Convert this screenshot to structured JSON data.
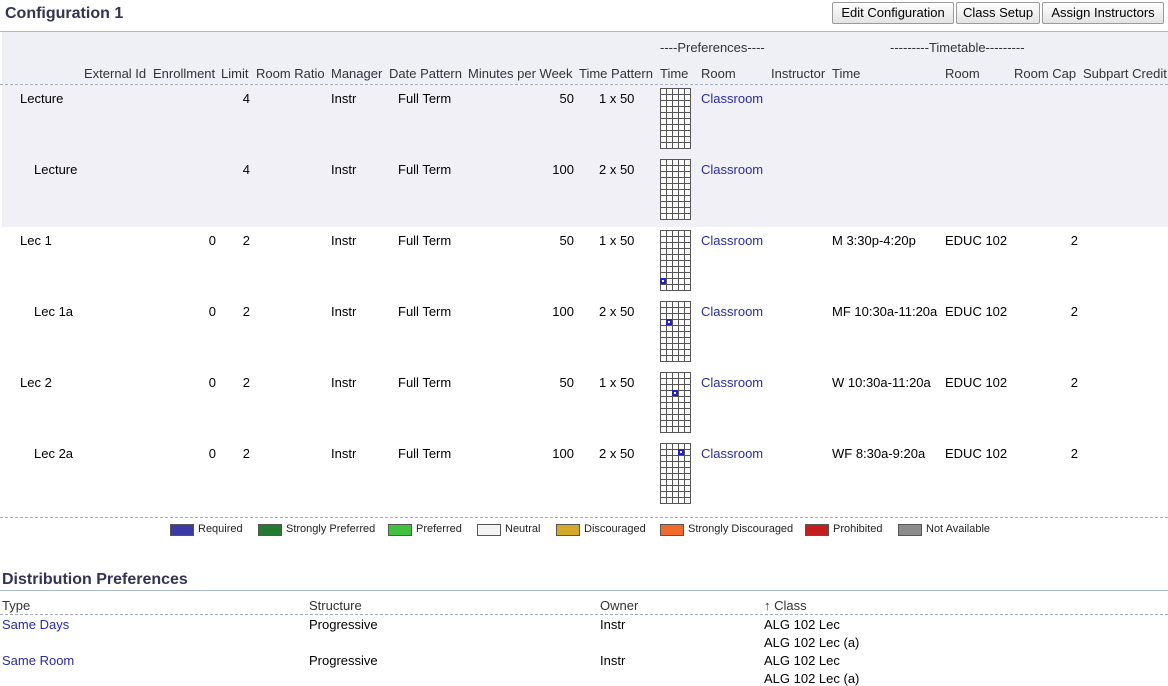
{
  "config": {
    "title": "Configuration 1",
    "buttons": {
      "edit": "Edit Configuration",
      "setup": "Class Setup",
      "assign": "Assign Instructors"
    }
  },
  "columns": {
    "group_preferences": "----Preferences----",
    "group_timetable": "---------Timetable---------",
    "external_id": "External Id",
    "enrollment": "Enrollment",
    "limit": "Limit",
    "room_ratio": "Room Ratio",
    "manager": "Manager",
    "date_pattern": "Date Pattern",
    "minutes": "Minutes per Week",
    "time_pattern": "Time Pattern",
    "pref_time": "Time",
    "pref_room": "Room",
    "instructor": "Instructor",
    "tt_time": "Time",
    "tt_room": "Room",
    "room_cap": "Room Cap",
    "subpart_credit": "Subpart Credit"
  },
  "rows": [
    {
      "name": "Lecture",
      "enrollment": "",
      "limit": "4",
      "manager": "Instr",
      "date_pattern": "Full Term",
      "minutes": "50",
      "time_pattern": "1 x 50",
      "room_pref": "Classroom",
      "tt_time": "",
      "tt_room": "",
      "room_cap": "",
      "pref_cell": null
    },
    {
      "name": "Lecture",
      "enrollment": "",
      "limit": "4",
      "manager": "Instr",
      "date_pattern": "Full Term",
      "minutes": "100",
      "time_pattern": "2 x 50",
      "room_pref": "Classroom",
      "tt_time": "",
      "tt_room": "",
      "room_cap": "",
      "pref_cell": null
    },
    {
      "name": "Lec 1",
      "enrollment": "0",
      "limit": "2",
      "manager": "Instr",
      "date_pattern": "Full Term",
      "minutes": "50",
      "time_pattern": "1 x 50",
      "room_pref": "Classroom",
      "tt_time": "M 3:30p-4:20p",
      "tt_room": "EDUC 102",
      "room_cap": "2",
      "pref_cell": {
        "col": 0,
        "row": 8
      }
    },
    {
      "name": "Lec 1a",
      "enrollment": "0",
      "limit": "2",
      "manager": "Instr",
      "date_pattern": "Full Term",
      "minutes": "100",
      "time_pattern": "2 x 50",
      "room_pref": "Classroom",
      "tt_time": "MF 10:30a-11:20a",
      "tt_room": "EDUC 102",
      "room_cap": "2",
      "pref_cell": {
        "col": 1,
        "row": 3
      }
    },
    {
      "name": "Lec 2",
      "enrollment": "0",
      "limit": "2",
      "manager": "Instr",
      "date_pattern": "Full Term",
      "minutes": "50",
      "time_pattern": "1 x 50",
      "room_pref": "Classroom",
      "tt_time": "W 10:30a-11:20a",
      "tt_room": "EDUC 102",
      "room_cap": "2",
      "pref_cell": {
        "col": 2,
        "row": 3
      }
    },
    {
      "name": "Lec 2a",
      "enrollment": "0",
      "limit": "2",
      "manager": "Instr",
      "date_pattern": "Full Term",
      "minutes": "100",
      "time_pattern": "2 x 50",
      "room_pref": "Classroom",
      "tt_time": "WF 8:30a-9:20a",
      "tt_room": "EDUC 102",
      "room_cap": "2",
      "pref_cell": {
        "col": 3,
        "row": 1
      }
    }
  ],
  "legend": [
    {
      "label": "Required",
      "color": "#3a3aa8"
    },
    {
      "label": "Strongly Preferred",
      "color": "#247a2e"
    },
    {
      "label": "Preferred",
      "color": "#3fc23f"
    },
    {
      "label": "Neutral",
      "color": "#f4f4f4"
    },
    {
      "label": "Discouraged",
      "color": "#d4a82a"
    },
    {
      "label": "Strongly Discouraged",
      "color": "#ef6a2c"
    },
    {
      "label": "Prohibited",
      "color": "#c41d1d"
    },
    {
      "label": "Not Available",
      "color": "#8c8c8c"
    }
  ],
  "distribution": {
    "title": "Distribution Preferences",
    "headers": {
      "type": "Type",
      "structure": "Structure",
      "owner": "Owner",
      "class": "↑ Class"
    },
    "rows": [
      {
        "type": "Same Days",
        "structure": "Progressive",
        "owner": "Instr",
        "classes": [
          "ALG 102 Lec",
          "ALG 102 Lec (a)"
        ]
      },
      {
        "type": "Same Room",
        "structure": "Progressive",
        "owner": "Instr",
        "classes": [
          "ALG 102 Lec",
          "ALG 102 Lec (a)"
        ]
      }
    ]
  }
}
